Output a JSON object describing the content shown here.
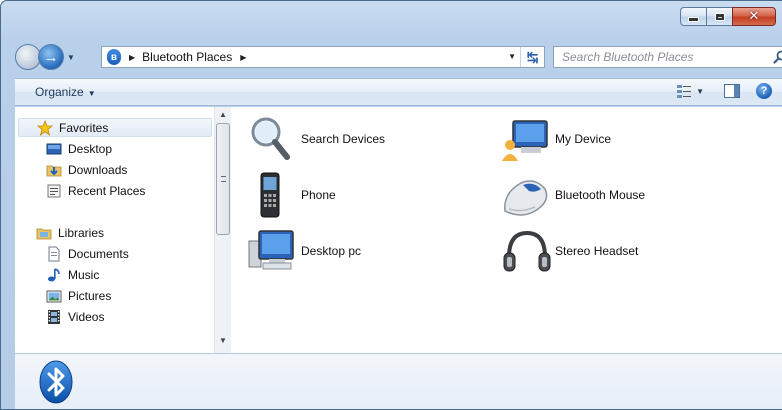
{
  "window": {
    "caption_buttons": [
      "minimize",
      "maximize",
      "close"
    ]
  },
  "address": {
    "breadcrumb": "Bluetooth Places"
  },
  "search": {
    "placeholder": "Search Bluetooth Places"
  },
  "toolbar": {
    "organize_label": "Organize"
  },
  "sidebar": {
    "favorites_label": "Favorites",
    "favorites": [
      "Desktop",
      "Downloads",
      "Recent Places"
    ],
    "libraries_label": "Libraries",
    "libraries": [
      "Documents",
      "Music",
      "Pictures",
      "Videos"
    ]
  },
  "files": {
    "items": [
      {
        "label": "Search Devices",
        "icon": "magnifier-icon"
      },
      {
        "label": "My Device",
        "icon": "my-device-icon"
      },
      {
        "label": "Phone",
        "icon": "phone-icon"
      },
      {
        "label": "Bluetooth Mouse",
        "icon": "mouse-icon"
      },
      {
        "label": "Desktop pc",
        "icon": "desktop-pc-icon"
      },
      {
        "label": "Stereo Headset",
        "icon": "headset-icon"
      }
    ]
  },
  "colors": {
    "frame": "#b9d0ea",
    "accent": "#1d5fb8",
    "toolbar": "#dde8f5"
  }
}
